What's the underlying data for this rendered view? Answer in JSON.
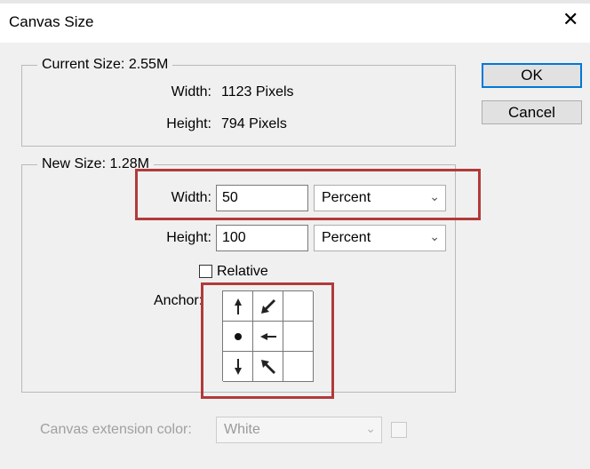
{
  "window": {
    "title": "Canvas Size",
    "close_glyph": "✕"
  },
  "buttons": {
    "ok": "OK",
    "cancel": "Cancel"
  },
  "current_size": {
    "legend": "Current Size: 2.55M",
    "width_label": "Width:",
    "width_value": "1123 Pixels",
    "height_label": "Height:",
    "height_value": "794 Pixels"
  },
  "new_size": {
    "legend": "New Size: 1.28M",
    "width_label": "Width:",
    "width_value": "50",
    "width_unit": "Percent",
    "height_label": "Height:",
    "height_value": "100",
    "height_unit": "Percent",
    "relative_label": "Relative",
    "relative_checked": false,
    "anchor_label": "Anchor:"
  },
  "anchor": {
    "selected": "middle-left",
    "cells": [
      "arrow-up-icon",
      "arrow-up-left-icon",
      "empty",
      "anchor-dot-icon",
      "arrow-left-icon",
      "empty",
      "arrow-down-icon",
      "arrow-down-left-icon",
      "empty"
    ]
  },
  "extension": {
    "label": "Canvas extension color:",
    "value": "White"
  },
  "highlight_color": "#b23a3a"
}
